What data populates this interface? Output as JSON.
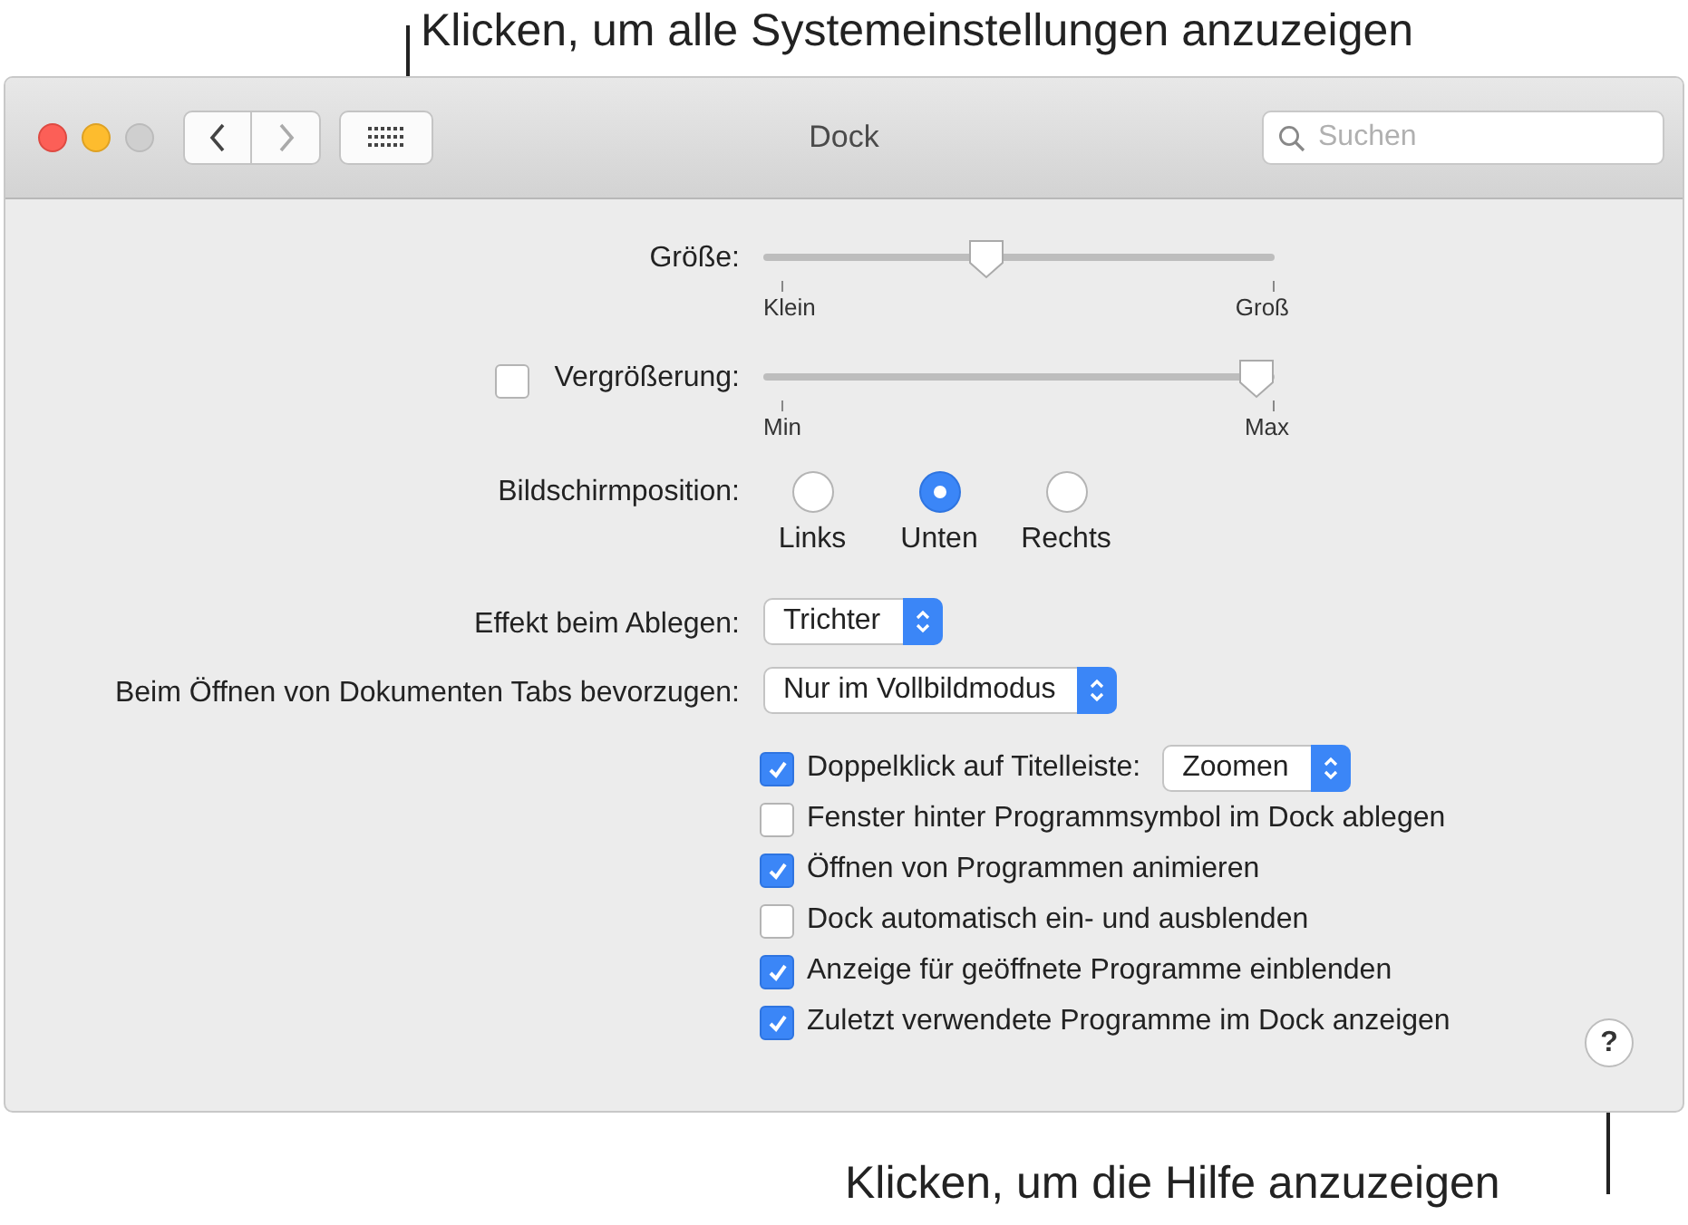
{
  "top_callout": "Klicken, um alle Systemeinstellungen anzuzeigen",
  "window": {
    "title": "Dock",
    "search": {
      "placeholder": "Suchen"
    }
  },
  "size": {
    "label": "Größe:",
    "level": 0.43,
    "min_label": "Klein",
    "max_label": "Groß"
  },
  "magnification": {
    "label": "Vergrößerung:",
    "checked": false,
    "level": 1,
    "min_label": "Min",
    "max_label": "Max"
  },
  "position": {
    "label": "Bildschirmposition:",
    "options": [
      {
        "label": "Links",
        "selected": false
      },
      {
        "label": "Unten",
        "selected": true
      },
      {
        "label": "Rechts",
        "selected": false
      }
    ]
  },
  "minimize_effect": {
    "label": "Effekt beim Ablegen:",
    "value": "Trichter"
  },
  "prefer_tabs": {
    "label": "Beim Öffnen von Dokumenten Tabs bevorzugen:",
    "value": "Nur im Vollbildmodus"
  },
  "options": [
    {
      "label": "Doppelklick auf Titelleiste:",
      "checked": true,
      "popup": "Zoomen"
    },
    {
      "label": "Fenster hinter Programmsymbol im Dock ablegen",
      "checked": false
    },
    {
      "label": "Öffnen von Programmen animieren",
      "checked": true
    },
    {
      "label": "Dock automatisch ein- und ausblenden",
      "checked": false
    },
    {
      "label": "Anzeige für geöffnete Programme einblenden",
      "checked": true
    },
    {
      "label": "Zuletzt verwendete Programme im Dock anzeigen",
      "checked": true
    }
  ],
  "help_button": "?",
  "bottom_callout": "Klicken, um die Hilfe anzuzeigen"
}
